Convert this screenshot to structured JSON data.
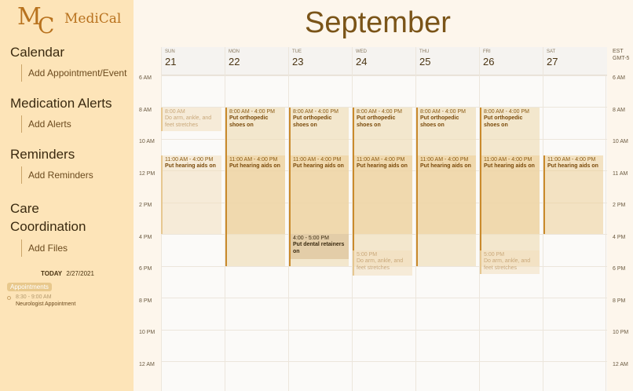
{
  "app": {
    "logo_letters": [
      "M",
      "C"
    ],
    "name": "MediCal"
  },
  "header": {
    "month": "September"
  },
  "sidebar": {
    "sections": [
      {
        "title": "Calendar",
        "link": "Add Appointment/Event"
      },
      {
        "title": "Medication Alerts",
        "link": "Add Alerts"
      },
      {
        "title": "Reminders",
        "link": "Add Reminders"
      },
      {
        "title_lines": [
          "Care",
          "Coordination"
        ],
        "link": "Add Files"
      }
    ],
    "today_label": "TODAY",
    "today_date": "2/27/2021",
    "appointments_badge": "Appointments",
    "appointment": {
      "time": "8:30 - 9:00 AM",
      "name": "Neurologist Appointment"
    }
  },
  "calendar": {
    "timezone": [
      "EST",
      "GMT-5"
    ],
    "days": [
      {
        "name": "SUN",
        "num": "21"
      },
      {
        "name": "MON",
        "num": "22"
      },
      {
        "name": "TUE",
        "num": "23"
      },
      {
        "name": "WED",
        "num": "24"
      },
      {
        "name": "THU",
        "num": "25"
      },
      {
        "name": "FRI",
        "num": "26"
      },
      {
        "name": "SAT",
        "num": "27"
      }
    ],
    "hours_left": [
      "6 AM",
      "8 AM",
      "10 AM",
      "12 PM",
      "2 PM",
      "4 PM",
      "6 PM",
      "8 PM",
      "10 PM",
      "12 AM"
    ],
    "hours_right": [
      "6 AM",
      "8 AM",
      "10 AM",
      "11 AM",
      "2 PM",
      "4 PM",
      "6 PM",
      "8 PM",
      "10 PM",
      "12 AM"
    ],
    "events": {
      "shoes": {
        "time": "8:00 AM - 4:00 PM",
        "title": "Put orthopedic shoes on"
      },
      "stretch_am": {
        "time": "8:00 AM",
        "title": "Do arm, ankle, and feet stretches"
      },
      "hearing": {
        "time": "11:00 AM - 4:00 PM",
        "title": "Put hearing aids on"
      },
      "retainers": {
        "time": "4:00 - 5:00 PM",
        "title": "Put dental retainers on"
      },
      "stretch_pm": {
        "time": "5:00 PM",
        "title": "Do arm, ankle, and feet stretches"
      }
    }
  }
}
